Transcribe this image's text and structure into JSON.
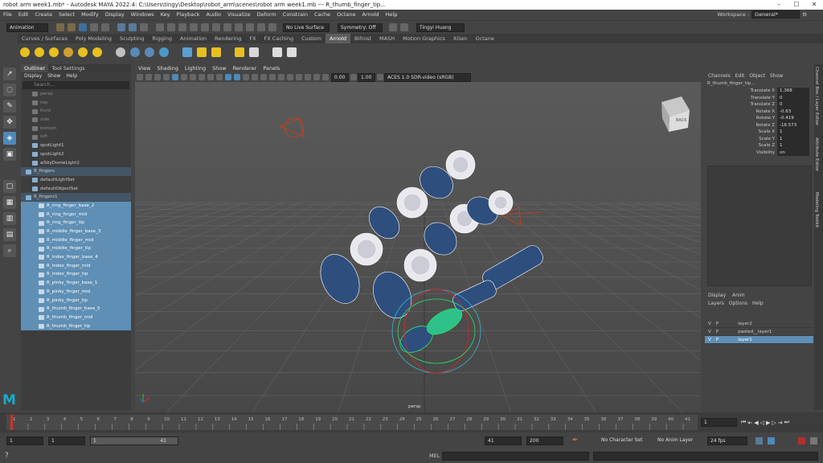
{
  "window": {
    "title": "robot arm week1.mb* - Autodesk MAYA 2022.4: C:\\Users\\tingy\\Desktop\\robot_arm\\scenes\\robot arm week1.mb  ---  R_thumb_finger_tip...",
    "minimize": "–",
    "maximize": "☐",
    "close": "✕"
  },
  "menus": [
    "File",
    "Edit",
    "Create",
    "Select",
    "Modify",
    "Display",
    "Windows",
    "Key",
    "Playback",
    "Audio",
    "Visualize",
    "Deform",
    "Constrain",
    "Cache",
    "Octane",
    "Arnold",
    "Help"
  ],
  "workspace": {
    "label": "Workspace :",
    "value": "General*"
  },
  "statusline": {
    "menuset": "Animation",
    "live_surface": "No Live Surface",
    "symmetry": "Symmetry: Off",
    "user": "Tingyi Huang"
  },
  "shelf_tabs": [
    "Curves / Surfaces",
    "Poly Modeling",
    "Sculpting",
    "Rigging",
    "Animation",
    "Rendering",
    "FX",
    "FX Caching",
    "Custom",
    "Arnold",
    "Bifrost",
    "MASH",
    "Motion Graphics",
    "XGen",
    "Octane"
  ],
  "shelf_active": "Arnold",
  "outliner": {
    "tabs": [
      "Outliner",
      "Tool Settings"
    ],
    "menus": [
      "Display",
      "Show",
      "Help"
    ],
    "search_placeholder": "Search...",
    "items": [
      {
        "label": "persp",
        "state": "dim",
        "indent": 1
      },
      {
        "label": "top",
        "state": "dim",
        "indent": 1
      },
      {
        "label": "front",
        "state": "dim",
        "indent": 1
      },
      {
        "label": "side",
        "state": "dim",
        "indent": 1
      },
      {
        "label": "bottom",
        "state": "dim",
        "indent": 1
      },
      {
        "label": "left",
        "state": "dim",
        "indent": 1
      },
      {
        "label": "spotLight1",
        "state": "normal",
        "indent": 1
      },
      {
        "label": "spotLight2",
        "state": "normal",
        "indent": 1
      },
      {
        "label": "aiSkyDomeLight2",
        "state": "normal",
        "indent": 1
      },
      {
        "label": "R_fingers",
        "state": "hl",
        "indent": 0
      },
      {
        "label": "defaultLightSet",
        "state": "normal",
        "indent": 1
      },
      {
        "label": "defaultObjectSet",
        "state": "normal",
        "indent": 1
      },
      {
        "label": "R_fingers1",
        "state": "hl",
        "indent": 0
      },
      {
        "label": "R_ring_finger_base_2",
        "state": "sel",
        "indent": 2
      },
      {
        "label": "R_ring_finger_mid",
        "state": "sel",
        "indent": 2
      },
      {
        "label": "R_ring_finger_tip",
        "state": "sel",
        "indent": 2
      },
      {
        "label": "R_middle_finger_base_3",
        "state": "sel",
        "indent": 2
      },
      {
        "label": "R_middle_finger_mid",
        "state": "sel",
        "indent": 2
      },
      {
        "label": "R_middle_finger_tip",
        "state": "sel",
        "indent": 2
      },
      {
        "label": "R_index_finger_base_4",
        "state": "sel",
        "indent": 2
      },
      {
        "label": "R_index_finger_mid",
        "state": "sel",
        "indent": 2
      },
      {
        "label": "R_index_finger_tip",
        "state": "sel",
        "indent": 2
      },
      {
        "label": "R_pinky_finger_base_1",
        "state": "sel",
        "indent": 2
      },
      {
        "label": "R_pinky_finger_mid",
        "state": "sel",
        "indent": 2
      },
      {
        "label": "R_pinky_finger_tip",
        "state": "sel",
        "indent": 2
      },
      {
        "label": "R_thumb_finger_base_5",
        "state": "sel",
        "indent": 2
      },
      {
        "label": "R_thumb_finger_mid",
        "state": "sel",
        "indent": 2
      },
      {
        "label": "R_thumb_finger_tip",
        "state": "sel",
        "indent": 2
      }
    ]
  },
  "viewport": {
    "menus": [
      "View",
      "Shading",
      "Lighting",
      "Show",
      "Renderer",
      "Panels"
    ],
    "exposure": "0.00",
    "gamma": "1.00",
    "colorspace": "ACES 1.0 SDR-video (sRGB)",
    "camera": "persp",
    "viewcube": "BACK"
  },
  "channelbox": {
    "menus": [
      "Channels",
      "Edit",
      "Object",
      "Show"
    ],
    "object": "R_thumb_finger_tip...",
    "attrs": [
      {
        "name": "Translate X",
        "value": "1.368"
      },
      {
        "name": "Translate Y",
        "value": "0"
      },
      {
        "name": "Translate Z",
        "value": "0"
      },
      {
        "name": "Rotate X",
        "value": "-0.63"
      },
      {
        "name": "Rotate Y",
        "value": "-0.419"
      },
      {
        "name": "Rotate Z",
        "value": "-16.573"
      },
      {
        "name": "Scale X",
        "value": "1"
      },
      {
        "name": "Scale Y",
        "value": "1"
      },
      {
        "name": "Scale Z",
        "value": "1"
      },
      {
        "name": "Visibility",
        "value": "on"
      }
    ],
    "side_tabs": [
      "Channel Box / Layer Editor",
      "Attribute Editor",
      "Modeling Toolkit"
    ]
  },
  "layers": {
    "tabs": [
      "Display",
      "Anim"
    ],
    "menus": [
      "Layers",
      "Options",
      "Help"
    ],
    "rows": [
      {
        "v": "V",
        "p": "P",
        "name": "layer2",
        "selected": false
      },
      {
        "v": "V",
        "p": "P",
        "name": "pasted__layer1",
        "selected": false
      },
      {
        "v": "V",
        "p": "P",
        "name": "layer1",
        "selected": true
      }
    ]
  },
  "timeline": {
    "ticks": [
      "1",
      "2",
      "3",
      "4",
      "5",
      "6",
      "7",
      "8",
      "9",
      "10",
      "11",
      "12",
      "13",
      "14",
      "15",
      "16",
      "17",
      "18",
      "19",
      "20",
      "21",
      "22",
      "23",
      "24",
      "25",
      "26",
      "27",
      "28",
      "29",
      "30",
      "31",
      "32",
      "33",
      "34",
      "35",
      "36",
      "37",
      "38",
      "39",
      "40",
      "41"
    ],
    "current_frame": "1"
  },
  "range": {
    "start": "1",
    "inner_start": "1",
    "slider_start": "1",
    "slider_end": "41",
    "inner_end": "41",
    "end": "200",
    "char_set": "No Character Set",
    "anim_layer": "No Anim Layer",
    "fps": "24 fps"
  },
  "cmdline": {
    "label": "MEL"
  }
}
